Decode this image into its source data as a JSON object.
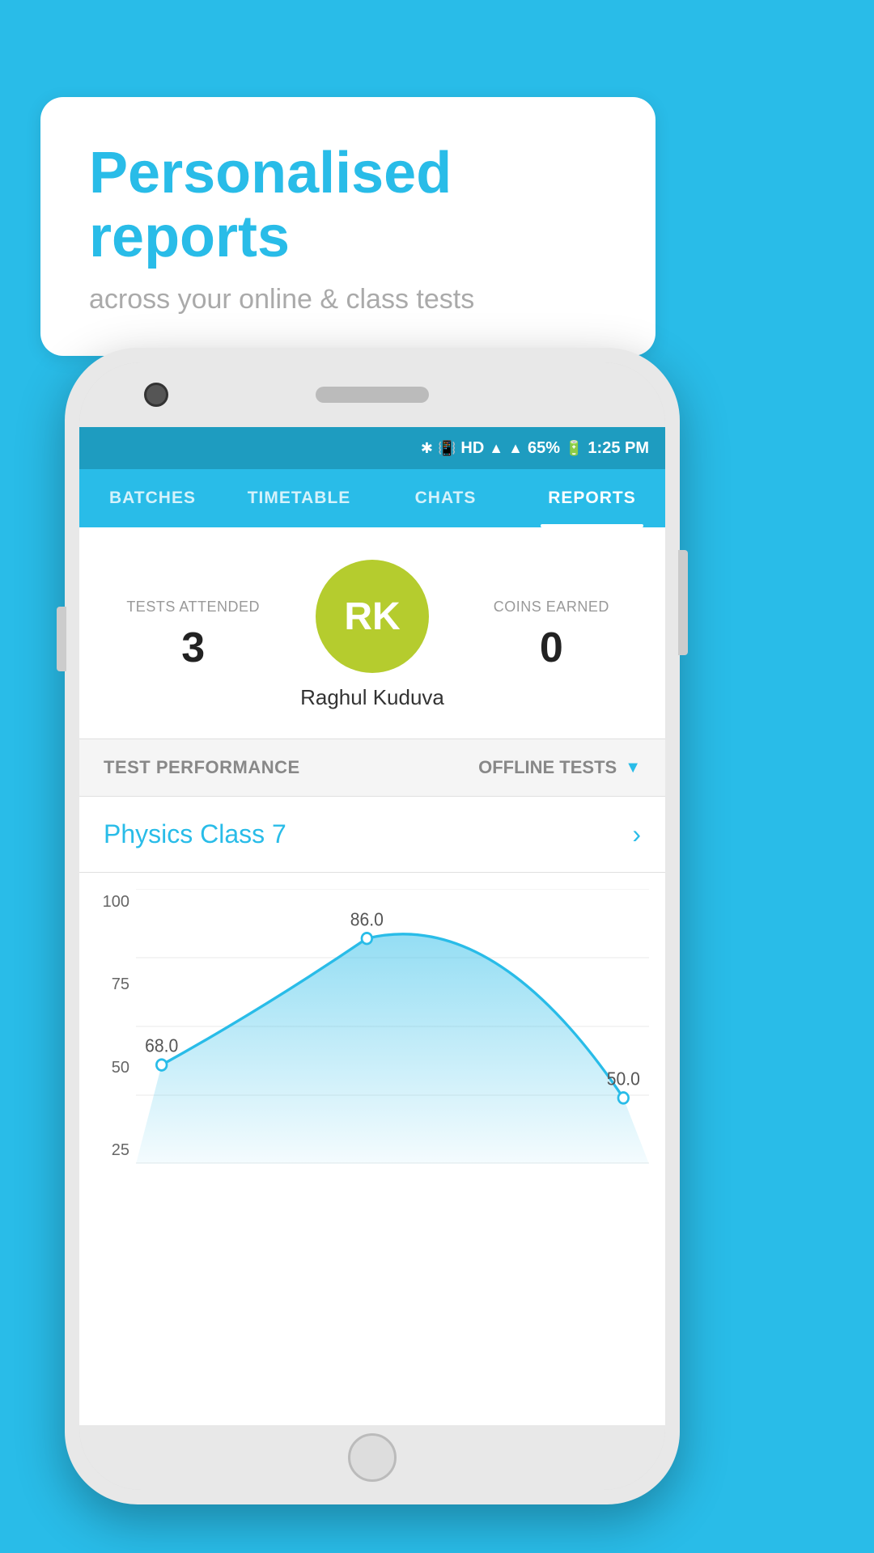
{
  "background_color": "#29bce8",
  "bubble": {
    "title": "Personalised reports",
    "subtitle": "across your online & class tests"
  },
  "statusbar": {
    "time": "1:25 PM",
    "battery": "65%",
    "signal": "HD"
  },
  "nav": {
    "tabs": [
      {
        "label": "BATCHES",
        "active": false
      },
      {
        "label": "TIMETABLE",
        "active": false
      },
      {
        "label": "CHATS",
        "active": false
      },
      {
        "label": "REPORTS",
        "active": true
      }
    ]
  },
  "profile": {
    "tests_attended_label": "TESTS ATTENDED",
    "tests_attended_value": "3",
    "coins_earned_label": "COINS EARNED",
    "coins_earned_value": "0",
    "avatar_initials": "RK",
    "user_name": "Raghul Kuduva"
  },
  "filter": {
    "performance_label": "TEST PERFORMANCE",
    "dropdown_label": "OFFLINE TESTS"
  },
  "class": {
    "name": "Physics Class 7"
  },
  "chart": {
    "y_labels": [
      "100",
      "75",
      "50",
      "25"
    ],
    "data_points": [
      {
        "x": 0.05,
        "y": 0.22,
        "value": "68.0"
      },
      {
        "x": 0.45,
        "y": 0.06,
        "value": "86.0"
      },
      {
        "x": 0.95,
        "y": 0.38,
        "value": "50.0"
      }
    ]
  }
}
